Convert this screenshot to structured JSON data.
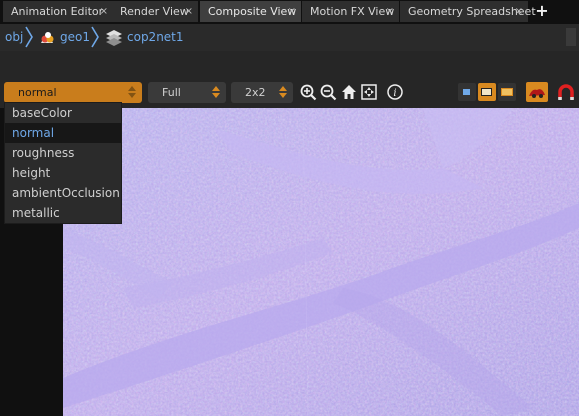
{
  "tabs": [
    {
      "label": "Animation Editor",
      "close": "×",
      "active": false
    },
    {
      "label": "Render View",
      "close": "×",
      "active": false
    },
    {
      "label": "Composite View",
      "close": "×",
      "active": true
    },
    {
      "label": "Motion FX View",
      "close": "×",
      "active": false
    },
    {
      "label": "Geometry Spreadsheet",
      "close": "×",
      "active": false
    }
  ],
  "add_tab": "+",
  "path": {
    "items": [
      {
        "label": "obj",
        "icon": null
      },
      {
        "label": "geo1",
        "icon": "geo-node-icon"
      },
      {
        "label": "cop2net1",
        "icon": "cop-network-icon"
      }
    ]
  },
  "toolbar": {
    "plane_select": {
      "value": "normal"
    },
    "resolution_select": {
      "value": "Full"
    },
    "split_select": {
      "value": "2x2"
    },
    "buttons": [
      "zoom-in-icon",
      "zoom-out-icon",
      "home-icon",
      "frame-icon",
      "info-icon"
    ],
    "view_buttons": [
      "single-view-icon",
      "split-view-icon",
      "compare-view-icon"
    ],
    "colors": {
      "accent": "#d98a20",
      "link": "#6fa8e8"
    }
  },
  "dropdown": {
    "options": [
      "baseColor",
      "normal",
      "roughness",
      "height",
      "ambientOcclusion",
      "metallic"
    ],
    "selected": "normal"
  }
}
